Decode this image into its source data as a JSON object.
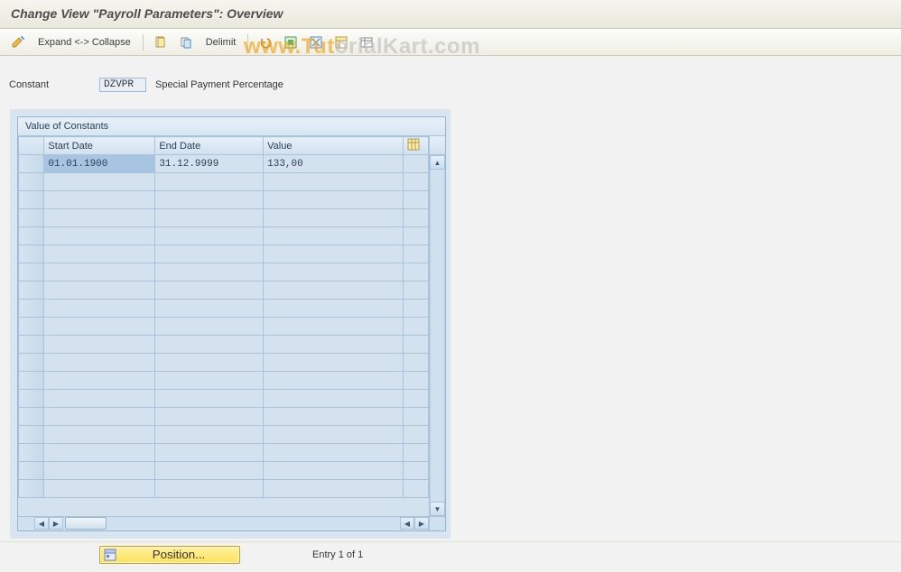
{
  "title": "Change View \"Payroll Parameters\": Overview",
  "watermark": {
    "a": "www.Tut",
    "b": "orialKart.com"
  },
  "toolbar": {
    "expand_collapse_label": "Expand <-> Collapse",
    "delimit_label": "Delimit"
  },
  "detail": {
    "constant_label": "Constant",
    "constant_value": "DZVPR",
    "constant_desc": "Special Payment Percentage"
  },
  "panel": {
    "title": "Value of Constants",
    "columns": {
      "start": "Start Date",
      "end": "End Date",
      "value": "Value"
    },
    "rows": [
      {
        "start": "01.01.1900",
        "end": "31.12.9999",
        "value": "133,00"
      }
    ],
    "empty_row_count": 18
  },
  "footer": {
    "position_button": "Position...",
    "entry_text": "Entry 1 of 1"
  }
}
